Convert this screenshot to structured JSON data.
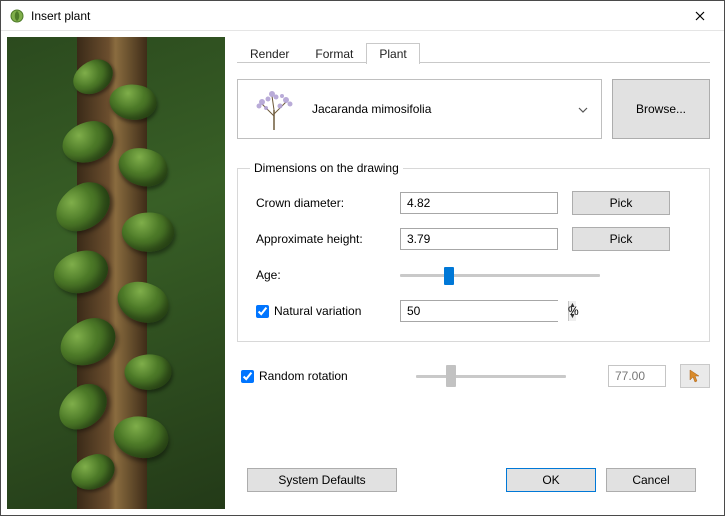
{
  "window": {
    "title": "Insert plant"
  },
  "tabs": {
    "render": "Render",
    "format": "Format",
    "plant": "Plant",
    "active": "plant"
  },
  "plant": {
    "name": "Jacaranda mimosifolia",
    "browse": "Browse..."
  },
  "dimensions": {
    "legend": "Dimensions on the drawing",
    "crown_label": "Crown diameter:",
    "crown_value": "4.82",
    "height_label": "Approximate height:",
    "height_value": "3.79",
    "age_label": "Age:",
    "pick": "Pick",
    "natural_variation_label": "Natural variation",
    "natural_variation_checked": true,
    "natural_variation_value": "50",
    "percent": "%"
  },
  "rotation": {
    "label": "Random rotation",
    "checked": true,
    "value": "77.00"
  },
  "footer": {
    "system_defaults": "System Defaults",
    "ok": "OK",
    "cancel": "Cancel"
  }
}
